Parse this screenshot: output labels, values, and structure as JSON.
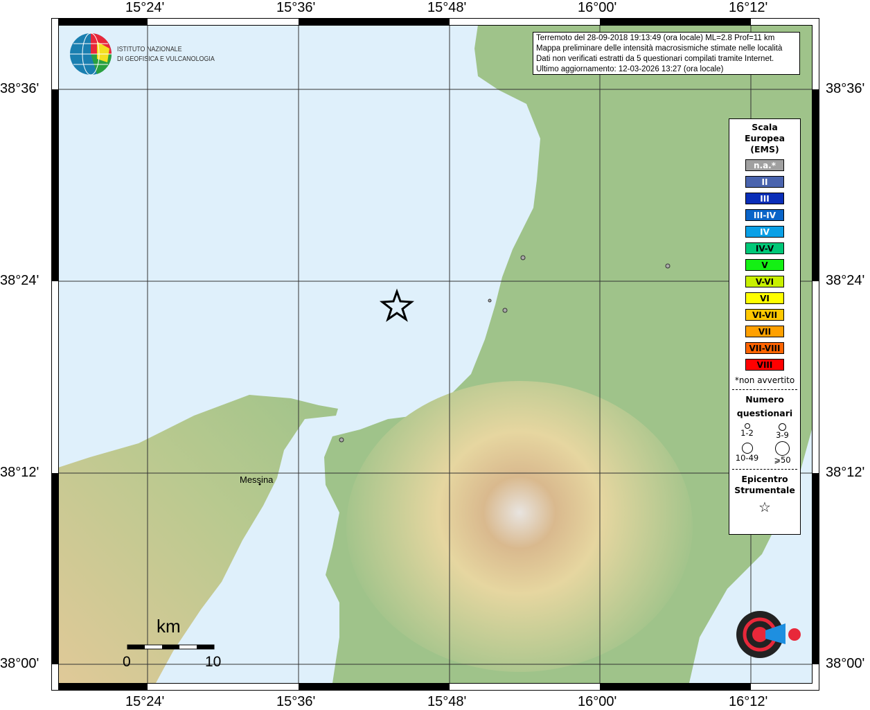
{
  "map": {
    "lon_ticks": [
      "15°24'",
      "15°36'",
      "15°48'",
      "16°00'",
      "16°12'"
    ],
    "lat_ticks": [
      "38°36'",
      "38°24'",
      "38°12'",
      "38°00'"
    ],
    "place_label": "Messina",
    "scale_unit": "km",
    "scale_start": "0",
    "scale_end": "10",
    "sea_color": "#dff0fb",
    "land_color": "#9fc38a",
    "epicenter_icon": "star-icon",
    "felt_points": 5
  },
  "logo": {
    "inst_line1": "ISTITUTO NAZIONALE",
    "inst_line2": "DI GEOFISICA E VULCANOLOGIA",
    "hsh": "www.haisentitoilterremoto.it"
  },
  "info": {
    "line1": "Terremoto del 28-09-2018 19:13:49 (ora locale) ML=2.8 Prof=11 km",
    "line2": "Mappa preliminare delle intensità macrosismiche stimate nelle località",
    "line3": "Dati non verificati estratti da 5 questionari compilati tramite Internet.",
    "line4": "Ultimo aggiornamento: 12-03-2026 13:27 (ora locale)"
  },
  "legend": {
    "title1": "Scala",
    "title2": "Europea",
    "title3": "(EMS)",
    "scale": [
      {
        "label": "n.a.*",
        "color": "#a0a0a0",
        "text": "#fff"
      },
      {
        "label": "II",
        "color": "#4a64ae",
        "text": "#fff"
      },
      {
        "label": "III",
        "color": "#0a2eb8",
        "text": "#fff"
      },
      {
        "label": "III-IV",
        "color": "#0a64c8",
        "text": "#fff"
      },
      {
        "label": "IV",
        "color": "#0aa0e6",
        "text": "#fff"
      },
      {
        "label": "IV-V",
        "color": "#00c878",
        "text": "#000"
      },
      {
        "label": "V",
        "color": "#14f014",
        "text": "#000"
      },
      {
        "label": "V-VI",
        "color": "#c8f000",
        "text": "#000"
      },
      {
        "label": "VI",
        "color": "#ffff00",
        "text": "#000"
      },
      {
        "label": "VI-VII",
        "color": "#ffc800",
        "text": "#000"
      },
      {
        "label": "VII",
        "color": "#ffa000",
        "text": "#000"
      },
      {
        "label": "VII-VIII",
        "color": "#ff6400",
        "text": "#000"
      },
      {
        "label": "VIII",
        "color": "#ff0000",
        "text": "#000"
      }
    ],
    "na_note": "*non avvertito",
    "count_title1": "Numero",
    "count_title2": "questionari",
    "counts": [
      "1-2",
      "3-9",
      "10-49",
      "⩾50"
    ],
    "epi_title1": "Epicentro",
    "epi_title2": "Strumentale"
  }
}
